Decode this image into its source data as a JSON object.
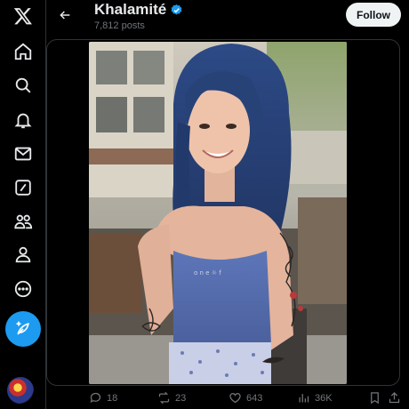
{
  "colors": {
    "background": "#000000",
    "accent": "#1d9bf0",
    "text_primary": "#e7e9ea",
    "text_secondary": "#71767b",
    "follow_bg": "#eff3f4"
  },
  "nav": {
    "items": [
      {
        "name": "x-logo-icon"
      },
      {
        "name": "home-icon"
      },
      {
        "name": "search-icon"
      },
      {
        "name": "notifications-bell-icon"
      },
      {
        "name": "messages-envelope-icon"
      },
      {
        "name": "grok-slash-icon"
      },
      {
        "name": "communities-icon"
      },
      {
        "name": "profile-icon"
      },
      {
        "name": "more-circle-icon"
      }
    ],
    "compose_icon": "feather-plus-icon"
  },
  "header": {
    "display_name": "Khalamité",
    "post_count": "7,812 posts",
    "follow_label": "Follow",
    "verified_icon": "verified-badge-icon"
  },
  "actions": {
    "replies": "18",
    "reposts": "23",
    "likes": "643",
    "views": "36K"
  }
}
